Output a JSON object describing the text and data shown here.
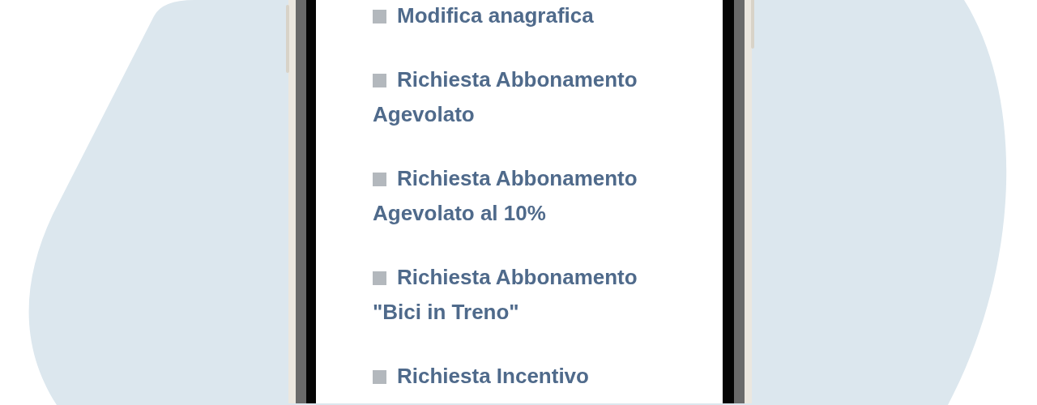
{
  "menu_items": [
    {
      "label": "Modifica anagrafica"
    },
    {
      "label": "Richiesta Abbonamento Agevolato"
    },
    {
      "label": "Richiesta Abbonamento Agevolato al 10%"
    },
    {
      "label": "Richiesta Abbonamento \"Bici in Treno\""
    },
    {
      "label": "Richiesta Incentivo"
    }
  ]
}
